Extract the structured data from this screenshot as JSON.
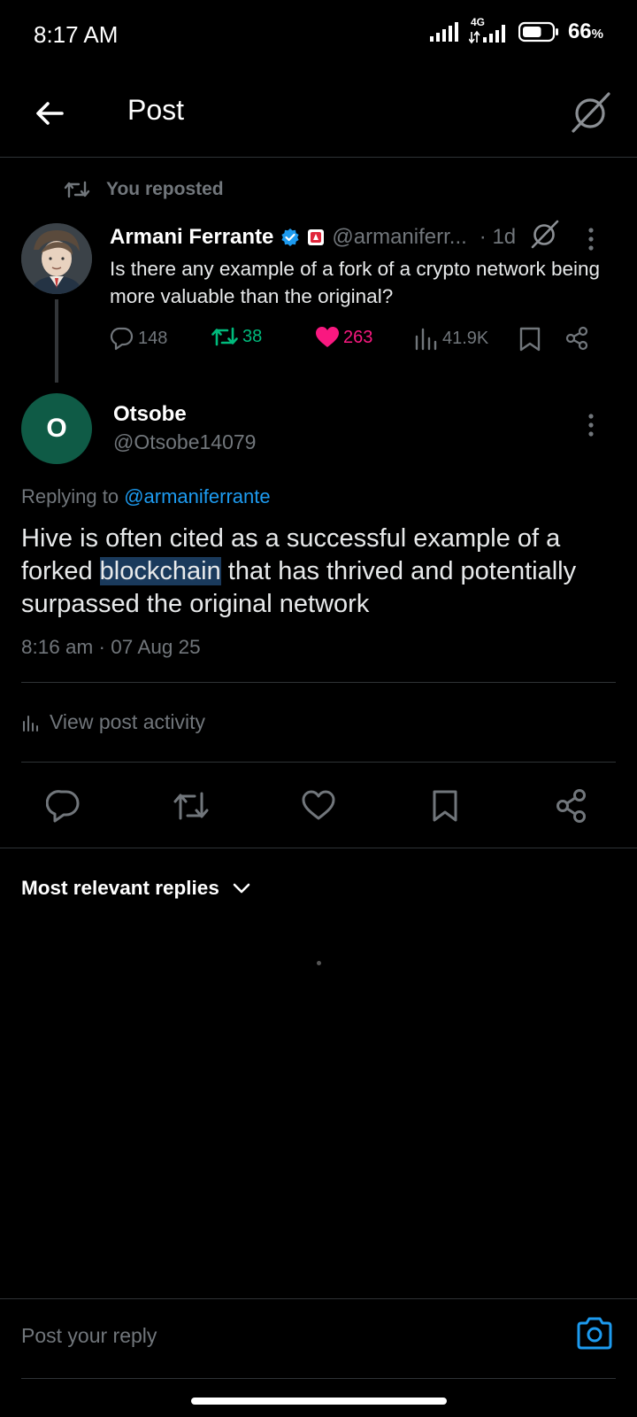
{
  "status_bar": {
    "time": "8:17 AM",
    "network": "4G",
    "battery_percent": "66",
    "battery_unit": "%",
    "battery_level": 0.66
  },
  "header": {
    "title": "Post"
  },
  "repost_banner": {
    "text": "You reposted"
  },
  "parent_post": {
    "author_name": "Armani Ferrante",
    "handle": "@armaniferr...",
    "time": "· 1d",
    "text": "Is there any example of a fork of a crypto network being more valuable than the original?",
    "replies": "148",
    "reposts": "38",
    "likes": "263",
    "views": "41.9K",
    "verified_color": "#1d9bf0",
    "repost_color": "#00ba7c",
    "like_color": "#f91880"
  },
  "reply_post": {
    "avatar_letter": "O",
    "avatar_color": "#0f5b46",
    "author_name": "Otsobe",
    "handle": "@Otsobe14079",
    "replying_to_label": "Replying to",
    "replying_to_handle": "@armaniferrante",
    "text_before": "Hive is often cited as a successful example of a forked ",
    "text_highlight": "blockchain",
    "text_after": " that has thrived and potentially surpassed the original network",
    "timestamp": "8:16 am · 07 Aug 25"
  },
  "view_activity": {
    "label": "View post activity"
  },
  "replies_section": {
    "sort_label": "Most relevant replies"
  },
  "composer": {
    "placeholder": "Post your reply"
  },
  "icons": {
    "back": "arrow-left-icon",
    "grok": "grok-icon",
    "repost": "repost-icon",
    "verified": "verified-badge-icon",
    "affiliate": "affiliate-badge-icon",
    "more": "more-vertical-icon",
    "reply": "reply-icon",
    "like": "heart-icon",
    "views": "views-bar-icon",
    "bookmark": "bookmark-icon",
    "share": "share-icon",
    "chevron": "chevron-down-icon",
    "camera": "camera-icon"
  },
  "accent_color": "#1d9bf0"
}
